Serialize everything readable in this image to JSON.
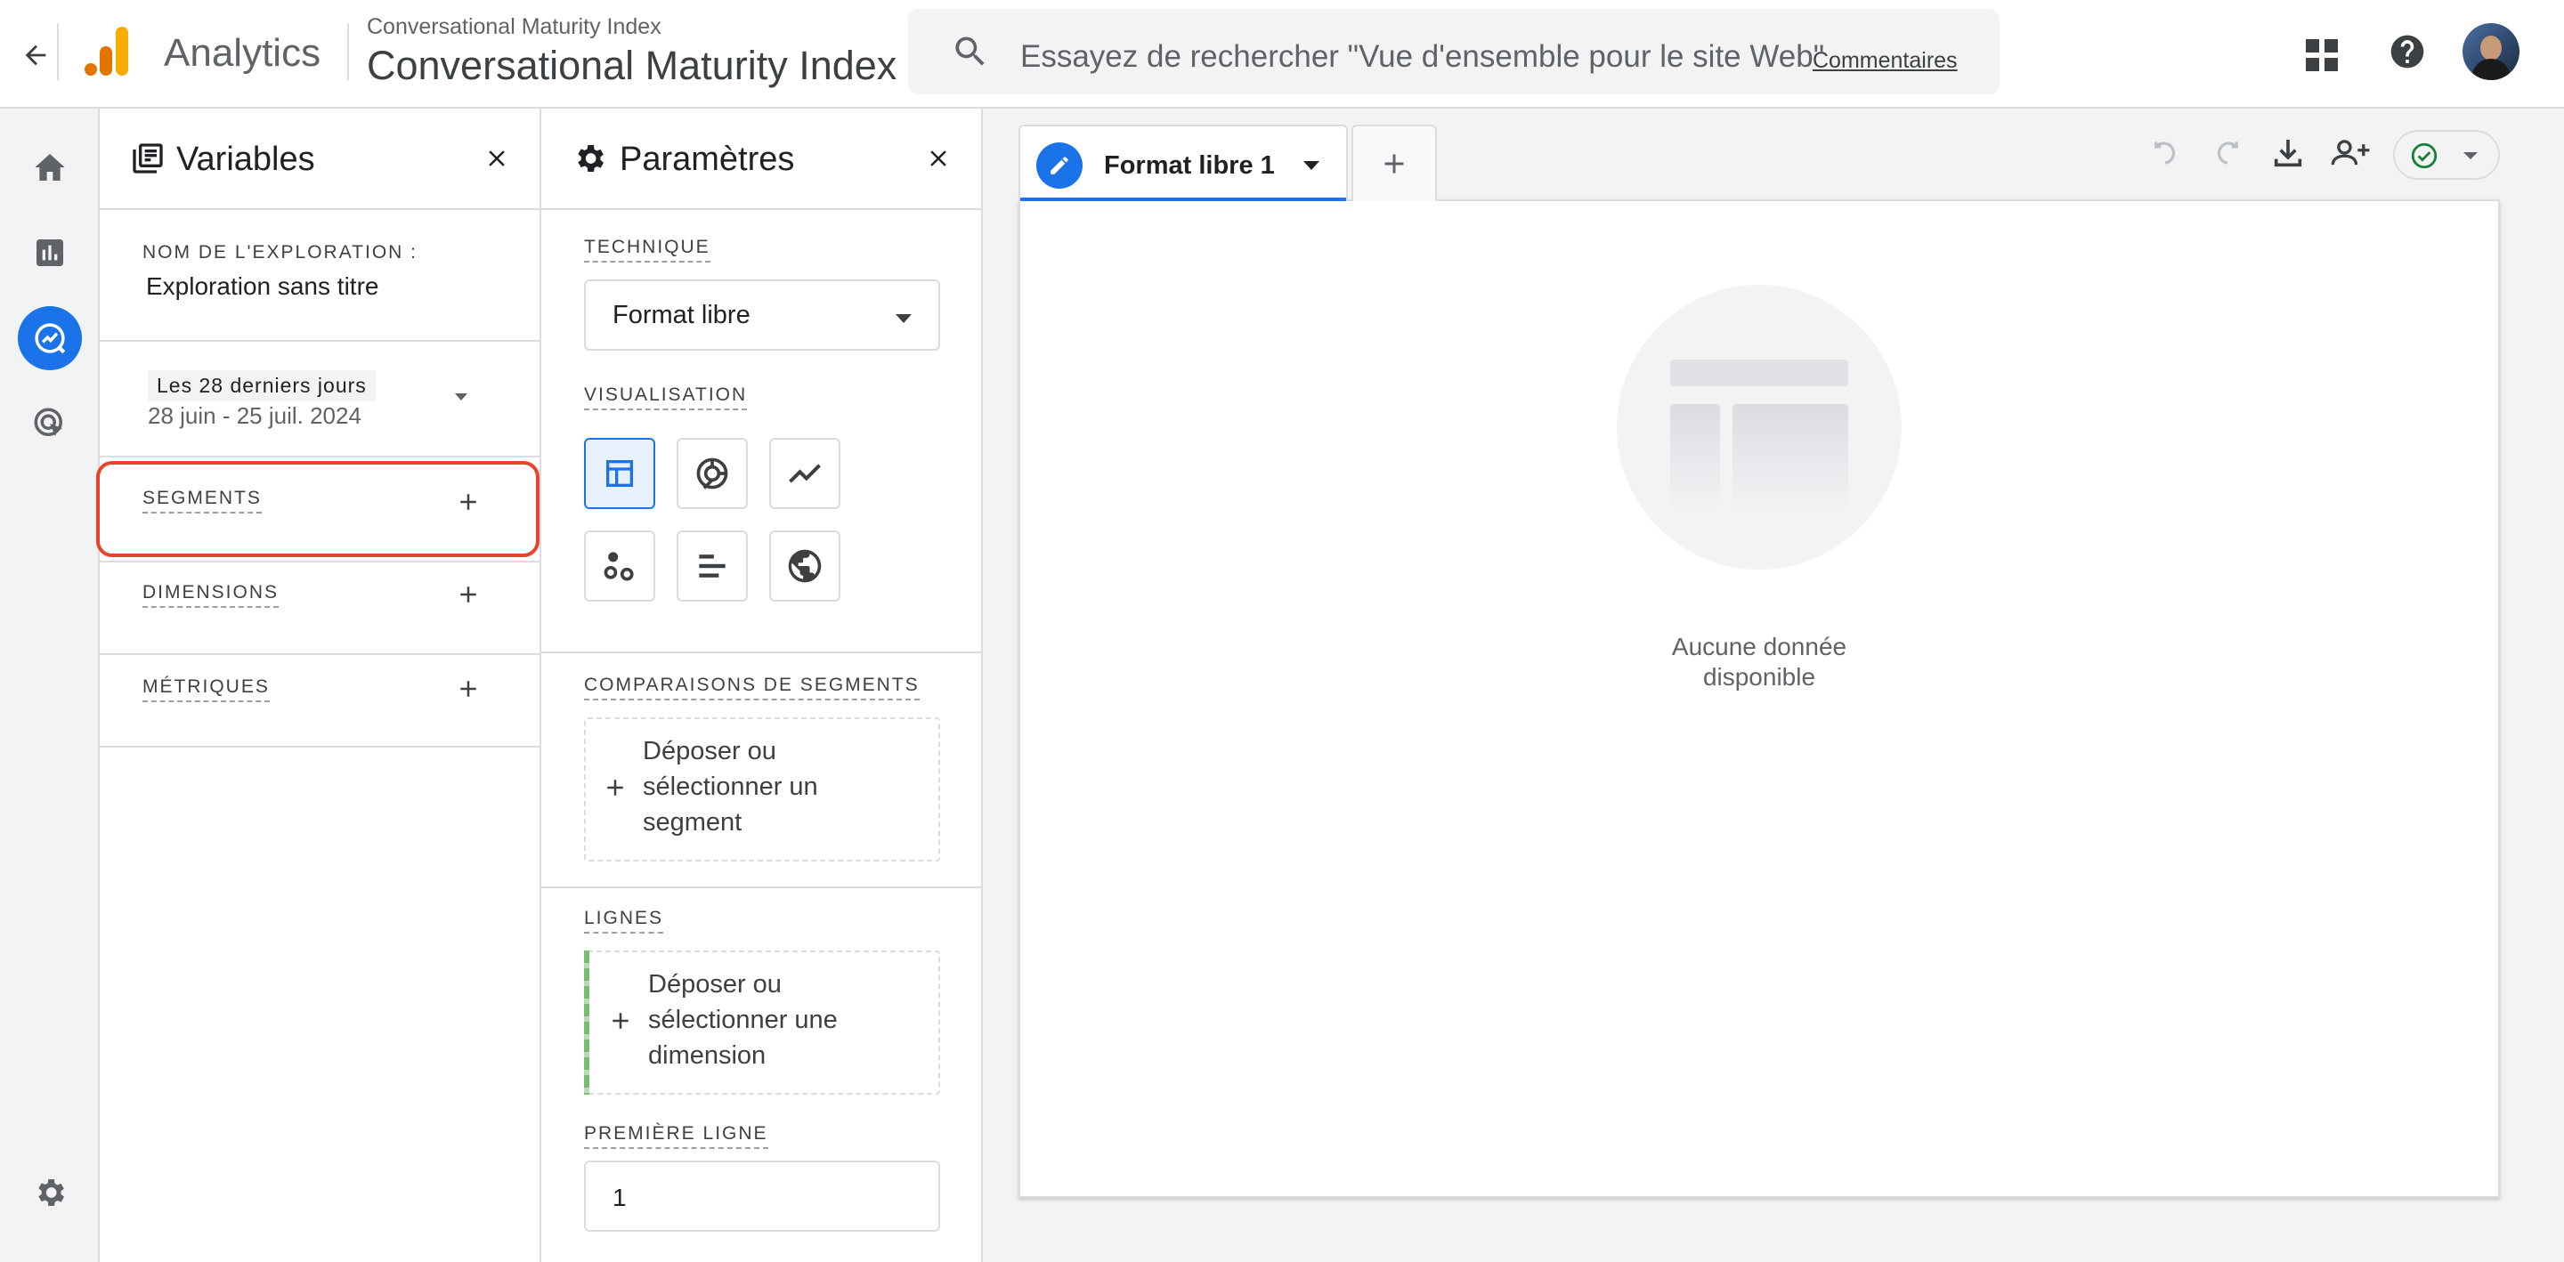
{
  "topbar": {
    "app_name": "Analytics",
    "property_small": "Conversational Maturity Index",
    "property_big": "Conversational Maturity Index",
    "search_placeholder": "Essayez de rechercher \"Vue d'ensemble pour le site Web\"",
    "search_link": "Commentaires"
  },
  "variables": {
    "title": "Variables",
    "exploration_name_label": "NOM DE L'EXPLORATION :",
    "exploration_name": "Exploration sans titre",
    "date_chip": "Les 28 derniers jours",
    "date_range": "28 juin - 25 juil. 2024",
    "segments_label": "SEGMENTS",
    "dimensions_label": "DIMENSIONS",
    "metrics_label": "MÉTRIQUES"
  },
  "settings": {
    "title": "Paramètres",
    "technique_label": "TECHNIQUE",
    "technique_value": "Format libre",
    "visualisation_label": "VISUALISATION",
    "visualisation_options": [
      "table-icon",
      "donut-chart-icon",
      "line-chart-icon",
      "scatter-plot-icon",
      "bar-chart-icon",
      "globe-icon"
    ],
    "selected_visualisation": "table-icon",
    "segment_comparisons_label": "COMPARAISONS DE SEGMENTS",
    "segment_drop_lines": [
      "Déposer ou",
      "sélectionner un",
      "segment"
    ],
    "lines_label": "LIGNES",
    "dimension_drop_lines": [
      "Déposer ou",
      "sélectionner une",
      "dimension"
    ],
    "first_line_label": "PREMIÈRE LIGNE",
    "first_line_value": "1"
  },
  "canvas": {
    "tab_label": "Format libre 1",
    "empty_lines": [
      "Aucune donnée",
      "disponible"
    ]
  },
  "colors": {
    "accent": "#1a73e8",
    "highlight": "#e8432e",
    "success": "#188038"
  }
}
